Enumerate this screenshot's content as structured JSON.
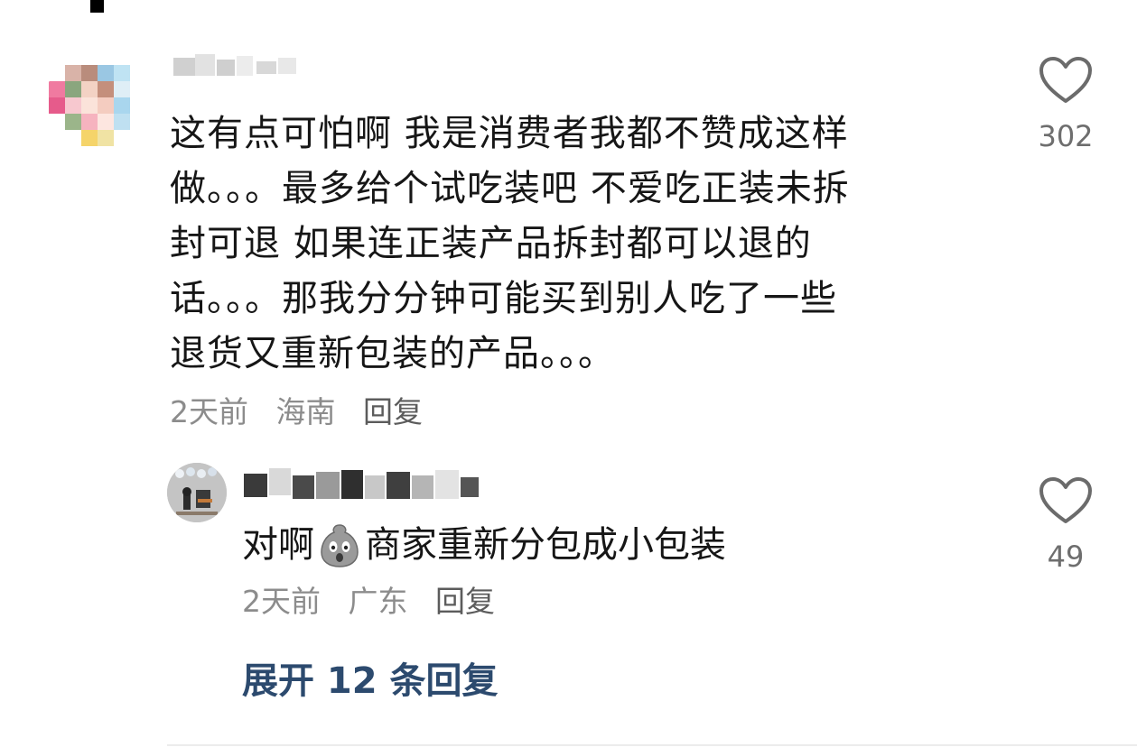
{
  "comment": {
    "username": "",
    "text_lines": [
      "这有点可怕啊 我是消费者我都不赞成这样",
      "做。。。最多给个试吃装吧 不爱吃正装未拆",
      "封可退 如果连正装产品拆封都可以退的",
      "话。。。那我分分钟可能买到别人吃了一些",
      "退货又重新包装的产品。。。"
    ],
    "time": "2天前",
    "location": "海南",
    "reply_label": "回复",
    "likes": "302"
  },
  "reply": {
    "username": "",
    "text_before": "对啊",
    "emoji": "scared-face-emoji",
    "text_after": "商家重新分包成小包装",
    "time": "2天前",
    "location": "广东",
    "reply_label": "回复",
    "likes": "49"
  },
  "expand_label": "展开 12 条回复",
  "colors": {
    "expand_link": "#2c4a6e",
    "meta_text": "#8c8c8c"
  }
}
